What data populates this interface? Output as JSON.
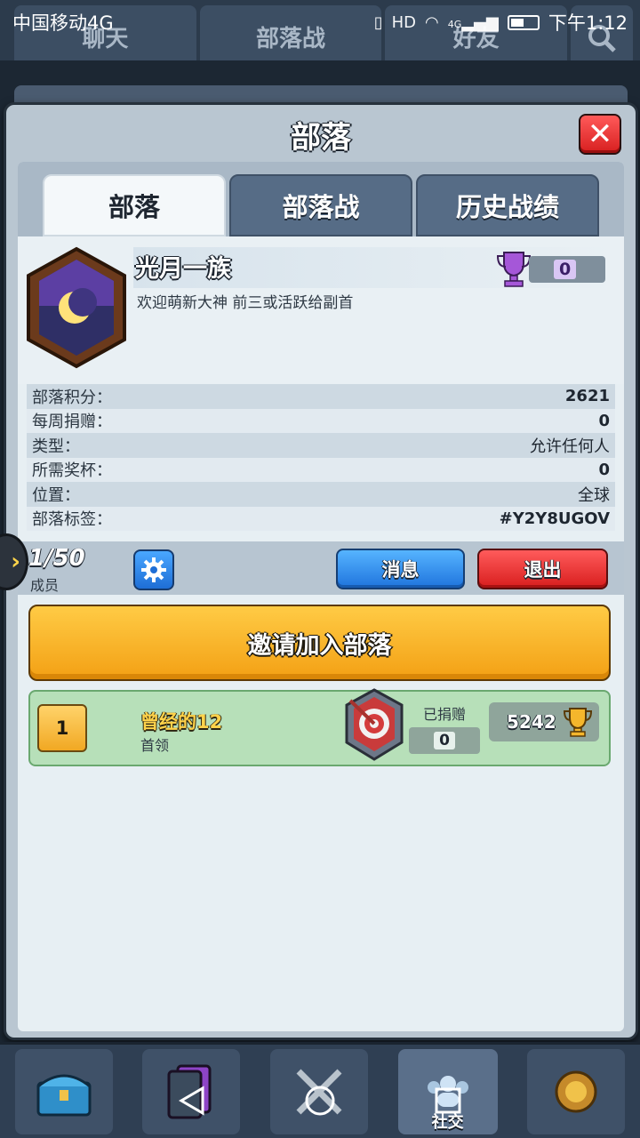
{
  "status_bar": {
    "carrier": "中国移动4G",
    "time": "下午1:12",
    "hd_label": "HD",
    "network_label": "4G"
  },
  "background_tabs": [
    "聊天",
    "部落战",
    "好友"
  ],
  "modal": {
    "title": "部落",
    "tabs": [
      {
        "label": "部落",
        "active": true
      },
      {
        "label": "部落战",
        "active": false
      },
      {
        "label": "历史战绩",
        "active": false
      }
    ]
  },
  "clan": {
    "name": "光月一族",
    "trophies": "0",
    "description": "欢迎萌新大神 前三或活跃给副首",
    "info": [
      {
        "label": "部落积分：",
        "value": "2621"
      },
      {
        "label": "每周捐赠：",
        "value": "0"
      },
      {
        "label": "类型：",
        "value": "允许任何人"
      },
      {
        "label": "所需奖杯：",
        "value": "0"
      },
      {
        "label": "位置：",
        "value": "全球"
      },
      {
        "label": "部落标签：",
        "value": "#Y2Y8UGOV"
      }
    ]
  },
  "members_bar": {
    "count": "1/50",
    "label": "成员",
    "message_button": "消息",
    "leave_button": "退出"
  },
  "invite_button": "邀请加入部落",
  "members": [
    {
      "rank": "1",
      "name": "曾经的12",
      "role": "首领",
      "donated_label": "已捐赠",
      "donated": "0",
      "trophies": "5242"
    }
  ],
  "bottom_nav": {
    "social_label": "社交"
  },
  "colors": {
    "accent_blue": "#1f74dd",
    "danger_red": "#d81e1e",
    "invite_orange": "#f3a014",
    "member_green": "#b7e0b9"
  }
}
